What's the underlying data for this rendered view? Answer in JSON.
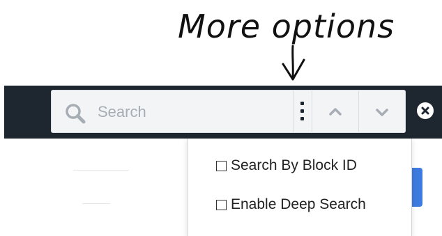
{
  "annotation": {
    "text": "More options"
  },
  "search": {
    "placeholder": "Search",
    "value": ""
  },
  "icons": {
    "search": "search-icon",
    "more": "more-options-icon",
    "previous": "chevron-up-icon",
    "next": "chevron-down-icon",
    "close": "close-icon",
    "callout_arrow": "arrow-down-icon"
  },
  "options": [
    {
      "label": "Search By Block ID",
      "checked": false
    },
    {
      "label": "Enable Deep Search",
      "checked": false
    }
  ],
  "colors": {
    "toolbar_bg": "#1e2630",
    "search_bg": "#f3f4f6",
    "accent": "#3d7be0",
    "icon_muted": "#a7adb5"
  }
}
